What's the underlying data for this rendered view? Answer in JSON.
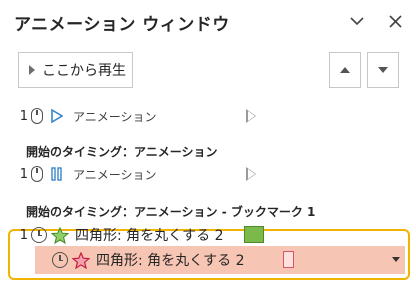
{
  "pane": {
    "title": "アニメーション ウィンドウ"
  },
  "toolbar": {
    "play_label": "ここから再生"
  },
  "rows": [
    {
      "number": "1",
      "trigger_icon": "mouse-icon",
      "effect_icon": "play-triangle-icon",
      "label": "アニメーション"
    },
    {
      "number": "1",
      "trigger_icon": "mouse-icon",
      "effect_icon": "pause-icon",
      "label": "アニメーション"
    }
  ],
  "headings": {
    "h1": "開始のタイミング：アニメーション",
    "h2": "開始のタイミング：アニメーション - ブックマーク 1"
  },
  "bookmark_rows": [
    {
      "number": "1",
      "trigger_icon": "clock-icon",
      "effect_icon": "green-star-icon",
      "label": "四角形: 角を丸くする 2",
      "bar_color": "#7bb94a"
    },
    {
      "number": "",
      "trigger_icon": "clock-icon",
      "effect_icon": "red-star-icon",
      "label": "四角形: 角を丸くする 2",
      "bar_color": "#d9536c",
      "selected": true
    }
  ],
  "colors": {
    "selection": "#f7c5b3",
    "highlight_outline": "#f0b400",
    "accent_blue": "#3a86c8"
  }
}
